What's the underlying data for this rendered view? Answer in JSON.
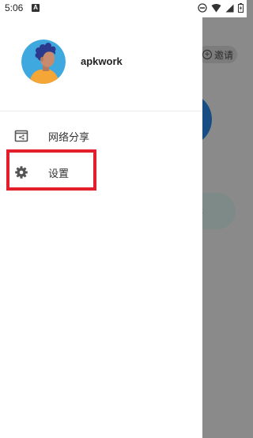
{
  "status_bar": {
    "time": "5:06",
    "notification_icon": "A",
    "icons": [
      "do-not-disturb-icon",
      "wifi-icon",
      "signal-icon",
      "battery-icon"
    ]
  },
  "drawer": {
    "user": {
      "name": "apkwork",
      "avatar": "avatar-illustration"
    },
    "menu": [
      {
        "label": "网络分享",
        "icon": "share-screen-icon"
      },
      {
        "label": "设置",
        "icon": "gear-icon",
        "highlighted": true
      }
    ]
  },
  "background": {
    "invite_label": "邀请"
  },
  "colors": {
    "highlight": "#e21f2a",
    "scrim": "#8a8a8a",
    "drawer_bg": "#ffffff"
  }
}
